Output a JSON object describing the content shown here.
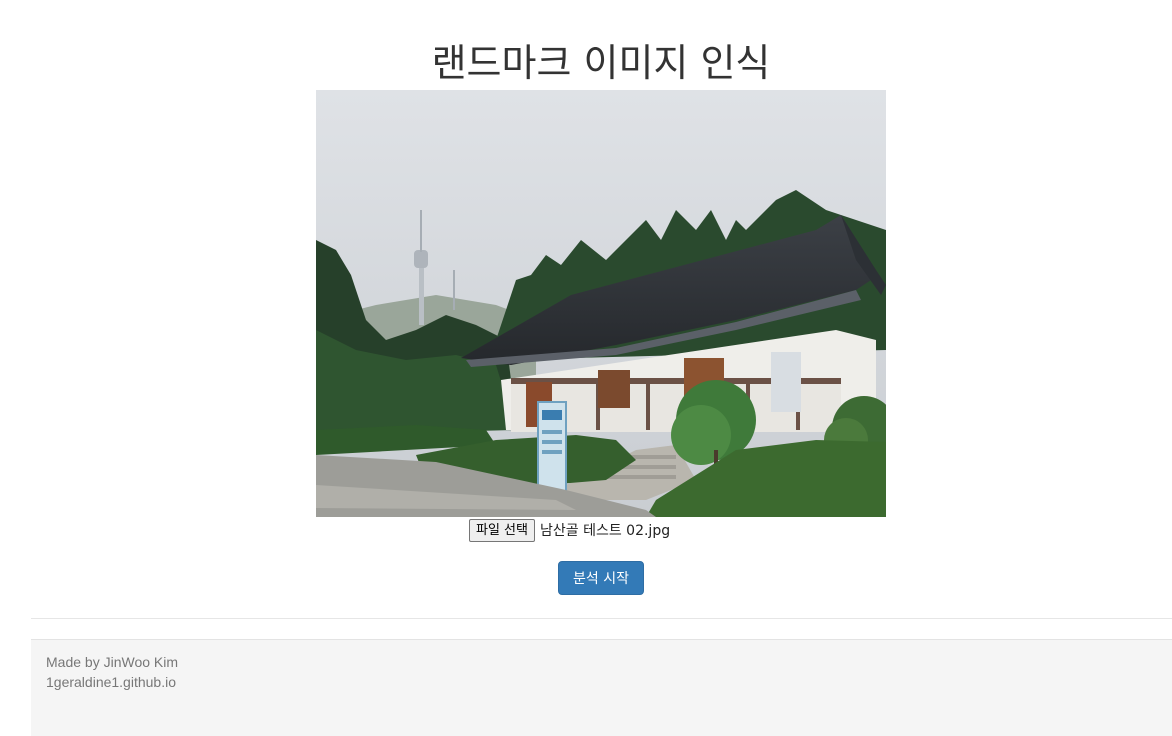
{
  "title": "랜드마크 이미지 인식",
  "upload": {
    "choose_file_label": "파일 선택",
    "file_name": "남산골 테스트 02.jpg"
  },
  "analyze_button_label": "분석 시작",
  "footer": {
    "author": "Made by JinWoo Kim",
    "site": "1geraldine1.github.io"
  }
}
